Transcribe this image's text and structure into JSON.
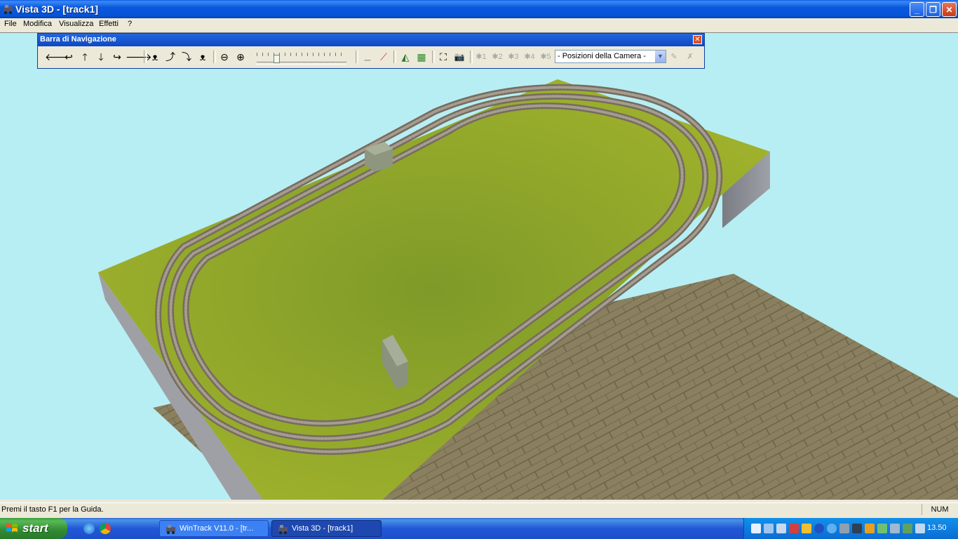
{
  "window": {
    "title": "Vista 3D - [track1]",
    "controls": {
      "minimize": "_",
      "maximize": "❐",
      "close": "✕"
    }
  },
  "menu": [
    "File",
    "Modifica",
    "Visualizza",
    "Effetti",
    "?"
  ],
  "nav_toolbar": {
    "title": "Barra di Navigazione",
    "close": "✕",
    "buttons": [
      {
        "icon": "arrow-left-icon",
        "glyph": "🡐"
      },
      {
        "icon": "turn-left-icon",
        "glyph": "↩"
      },
      {
        "icon": "arrow-up-icon",
        "glyph": "🡑"
      },
      {
        "icon": "arrow-down-icon",
        "glyph": "🡓"
      },
      {
        "icon": "turn-right-icon",
        "glyph": "↪"
      },
      {
        "icon": "arrow-right-icon",
        "glyph": "🡒"
      },
      {
        "icon": "view-orbit-icon",
        "glyph": "ᴥ"
      },
      {
        "icon": "view-up-icon",
        "glyph": "⤴"
      },
      {
        "icon": "view-down-icon",
        "glyph": "⤵"
      },
      {
        "icon": "view-reset-icon",
        "glyph": "ᴥ"
      },
      {
        "icon": "zoom-out-icon",
        "glyph": "⊖"
      },
      {
        "icon": "zoom-in-icon",
        "glyph": "⊕"
      },
      {
        "icon": "track-gray-icon",
        "glyph": "▁"
      },
      {
        "icon": "signal-icon",
        "glyph": "⟋"
      },
      {
        "icon": "terrain-icon",
        "glyph": "◭"
      },
      {
        "icon": "grid-icon",
        "glyph": "▦"
      },
      {
        "icon": "fit-view-icon",
        "glyph": "⛶"
      },
      {
        "icon": "camera-icon",
        "glyph": "📷"
      }
    ],
    "camera_slots": [
      "1",
      "2",
      "3",
      "4",
      "5"
    ],
    "slider_value": 0.22,
    "camera_select": "- Posizioni della Camera -",
    "camera_select_arrow": "▼",
    "extra_buttons": [
      {
        "icon": "camera-edit-icon",
        "glyph": "✎"
      },
      {
        "icon": "camera-delete-icon",
        "glyph": "✗"
      }
    ]
  },
  "status_bar": {
    "text": "Premi il tasto F1 per la Guida.",
    "num": "NUM"
  },
  "taskbar": {
    "start": "start",
    "tasks": [
      {
        "label": "WinTrack  V11.0 - [tr...",
        "active": false
      },
      {
        "label": "Vista 3D - [track1]",
        "active": true
      }
    ],
    "clock": "13.50"
  },
  "colors": {
    "sky": "#b7eef3",
    "grass": "#8fa626",
    "track": "#8c8070",
    "board_side": "#a8aab0",
    "floor": "#837a5a"
  }
}
